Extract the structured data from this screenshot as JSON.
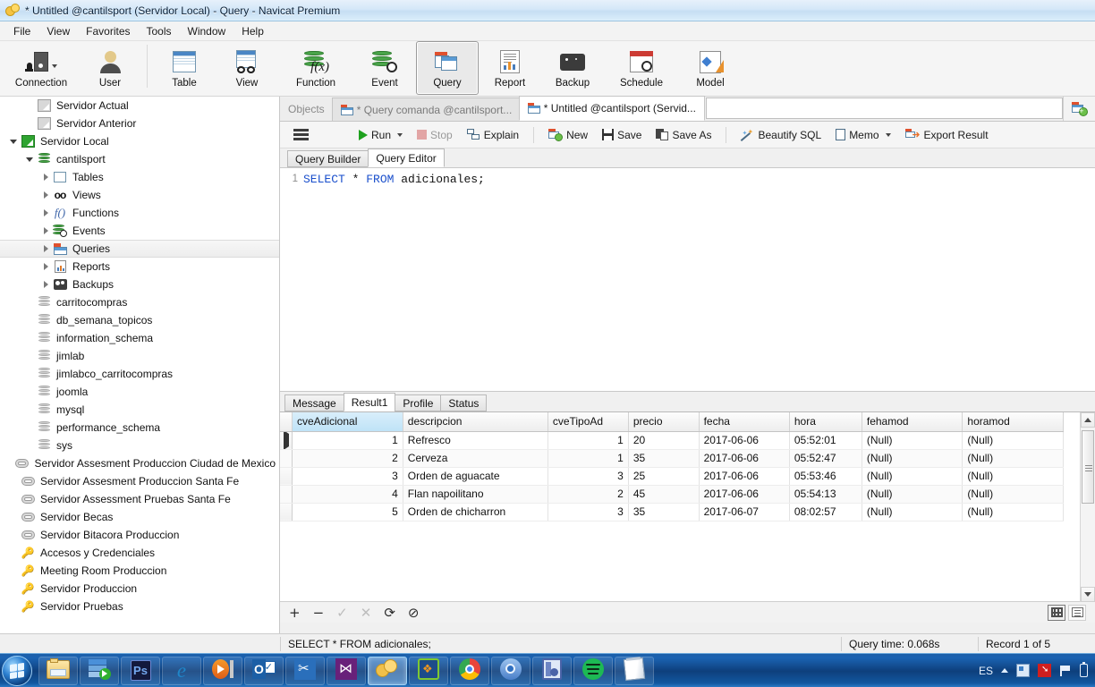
{
  "window": {
    "title": "* Untitled @cantilsport (Servidor Local) - Query - Navicat Premium",
    "logo_icon": "navicat-logo-icon"
  },
  "menubar": {
    "items": [
      "File",
      "View",
      "Favorites",
      "Tools",
      "Window",
      "Help"
    ]
  },
  "ribbon": {
    "groups": [
      {
        "buttons": [
          {
            "label": "Connection",
            "icon": "connection-icon",
            "has_dropdown": true,
            "active": false
          },
          {
            "label": "User",
            "icon": "user-icon",
            "has_dropdown": false,
            "active": false
          }
        ]
      },
      {
        "buttons": [
          {
            "label": "Table",
            "icon": "table-icon",
            "has_dropdown": false,
            "active": false
          },
          {
            "label": "View",
            "icon": "view-icon",
            "has_dropdown": false,
            "active": false
          },
          {
            "label": "Function",
            "icon": "function-icon",
            "has_dropdown": false,
            "active": false
          },
          {
            "label": "Event",
            "icon": "event-icon",
            "has_dropdown": false,
            "active": false
          },
          {
            "label": "Query",
            "icon": "query-icon",
            "has_dropdown": false,
            "active": true
          },
          {
            "label": "Report",
            "icon": "report-icon",
            "has_dropdown": false,
            "active": false
          },
          {
            "label": "Backup",
            "icon": "backup-icon",
            "has_dropdown": false,
            "active": false
          },
          {
            "label": "Schedule",
            "icon": "schedule-icon",
            "has_dropdown": false,
            "active": false
          },
          {
            "label": "Model",
            "icon": "model-icon",
            "has_dropdown": false,
            "active": false
          }
        ]
      }
    ]
  },
  "sidebar": {
    "items": [
      {
        "label": "Servidor Actual",
        "indent": 1,
        "icon": "server-offline-icon",
        "expander": "none",
        "selected": false
      },
      {
        "label": "Servidor Anterior",
        "indent": 1,
        "icon": "server-offline-icon",
        "expander": "none",
        "selected": false
      },
      {
        "label": "Servidor Local",
        "indent": 0,
        "icon": "server-online-icon",
        "expander": "expanded",
        "selected": false
      },
      {
        "label": "cantilsport",
        "indent": 1,
        "icon": "database-open-icon",
        "expander": "expanded",
        "selected": false
      },
      {
        "label": "Tables",
        "indent": 2,
        "icon": "table-icon",
        "expander": "collapsed",
        "selected": false
      },
      {
        "label": "Views",
        "indent": 2,
        "icon": "view-icon",
        "expander": "collapsed",
        "selected": false
      },
      {
        "label": "Functions",
        "indent": 2,
        "icon": "function-icon",
        "expander": "collapsed",
        "selected": false
      },
      {
        "label": "Events",
        "indent": 2,
        "icon": "event-icon",
        "expander": "collapsed",
        "selected": false
      },
      {
        "label": "Queries",
        "indent": 2,
        "icon": "query-icon",
        "expander": "collapsed",
        "selected": true
      },
      {
        "label": "Reports",
        "indent": 2,
        "icon": "report-icon",
        "expander": "collapsed",
        "selected": false
      },
      {
        "label": "Backups",
        "indent": 2,
        "icon": "backup-icon",
        "expander": "collapsed",
        "selected": false
      },
      {
        "label": "carritocompras",
        "indent": 1,
        "icon": "database-icon",
        "expander": "none",
        "selected": false
      },
      {
        "label": "db_semana_topicos",
        "indent": 1,
        "icon": "database-icon",
        "expander": "none",
        "selected": false
      },
      {
        "label": "information_schema",
        "indent": 1,
        "icon": "database-icon",
        "expander": "none",
        "selected": false
      },
      {
        "label": "jimlab",
        "indent": 1,
        "icon": "database-icon",
        "expander": "none",
        "selected": false
      },
      {
        "label": "jimlabco_carritocompras",
        "indent": 1,
        "icon": "database-icon",
        "expander": "none",
        "selected": false
      },
      {
        "label": "joomla",
        "indent": 1,
        "icon": "database-icon",
        "expander": "none",
        "selected": false
      },
      {
        "label": "mysql",
        "indent": 1,
        "icon": "database-icon",
        "expander": "none",
        "selected": false
      },
      {
        "label": "performance_schema",
        "indent": 1,
        "icon": "database-icon",
        "expander": "none",
        "selected": false
      },
      {
        "label": "sys",
        "indent": 1,
        "icon": "database-icon",
        "expander": "none",
        "selected": false
      },
      {
        "label": "Servidor Assesment Produccion Ciudad de Mexico",
        "indent": 0,
        "icon": "connection-icon",
        "expander": "none",
        "selected": false
      },
      {
        "label": "Servidor Assesment Produccion Santa Fe",
        "indent": 0,
        "icon": "connection-icon",
        "expander": "none",
        "selected": false
      },
      {
        "label": "Servidor Assessment Pruebas Santa Fe",
        "indent": 0,
        "icon": "connection-icon",
        "expander": "none",
        "selected": false
      },
      {
        "label": "Servidor Becas",
        "indent": 0,
        "icon": "connection-icon",
        "expander": "none",
        "selected": false
      },
      {
        "label": "Servidor Bitacora Produccion",
        "indent": 0,
        "icon": "connection-icon",
        "expander": "none",
        "selected": false
      },
      {
        "label": "Accesos y Credenciales",
        "indent": 0,
        "icon": "key-icon",
        "expander": "none",
        "selected": false
      },
      {
        "label": "Meeting Room Produccion",
        "indent": 0,
        "icon": "key-icon",
        "expander": "none",
        "selected": false
      },
      {
        "label": "Servidor Produccion",
        "indent": 0,
        "icon": "key-icon",
        "expander": "none",
        "selected": false
      },
      {
        "label": "Servidor Pruebas",
        "indent": 0,
        "icon": "key-icon",
        "expander": "none",
        "selected": false
      }
    ]
  },
  "tabstrip": {
    "tabs": [
      {
        "label": "Objects",
        "icon": "none",
        "active": false,
        "type": "objects"
      },
      {
        "label": "* Query comanda @cantilsport...",
        "icon": "query-tab-icon",
        "active": false,
        "type": "query"
      },
      {
        "label": "* Untitled @cantilsport (Servid...",
        "icon": "query-tab-icon",
        "active": true,
        "type": "query"
      }
    ],
    "add_tab_icon": "new-query-tab-icon",
    "search_value": "",
    "search_placeholder": ""
  },
  "query_toolbar": {
    "menu_icon": "hamburger-menu-icon",
    "buttons": [
      {
        "label": "Run",
        "icon": "run-play-icon",
        "has_dropdown": true,
        "enabled": true
      },
      {
        "label": "Stop",
        "icon": "stop-icon",
        "has_dropdown": false,
        "enabled": false
      },
      {
        "label": "Explain",
        "icon": "explain-icon",
        "has_dropdown": false,
        "enabled": true
      },
      {
        "label": "New",
        "icon": "new-query-icon",
        "has_dropdown": false,
        "enabled": true
      },
      {
        "label": "Save",
        "icon": "save-floppy-icon",
        "has_dropdown": false,
        "enabled": true
      },
      {
        "label": "Save As",
        "icon": "save-as-icon",
        "has_dropdown": false,
        "enabled": true
      },
      {
        "label": "Beautify SQL",
        "icon": "magic-wand-icon",
        "has_dropdown": false,
        "enabled": true
      },
      {
        "label": "Memo",
        "icon": "memo-icon",
        "has_dropdown": true,
        "enabled": true
      },
      {
        "label": "Export Result",
        "icon": "export-result-icon",
        "has_dropdown": false,
        "enabled": true
      }
    ]
  },
  "editor": {
    "subtabs": [
      {
        "label": "Query Builder",
        "active": false
      },
      {
        "label": "Query Editor",
        "active": true
      }
    ],
    "line_number": "1",
    "sql_tokens": [
      {
        "text": "SELECT",
        "type": "keyword"
      },
      {
        "text": " * ",
        "type": "operator"
      },
      {
        "text": "FROM",
        "type": "keyword"
      },
      {
        "text": " adicionales;",
        "type": "identifier"
      }
    ],
    "sql_text": "SELECT * FROM adicionales;"
  },
  "results": {
    "tabs": [
      {
        "label": "Message",
        "active": false
      },
      {
        "label": "Result1",
        "active": true
      },
      {
        "label": "Profile",
        "active": false
      },
      {
        "label": "Status",
        "active": false
      }
    ],
    "columns": [
      "cveAdicional",
      "descripcion",
      "cveTipoAd",
      "precio",
      "fecha",
      "hora",
      "fehamod",
      "horamod"
    ],
    "selected_column": "cveAdicional",
    "rows": [
      {
        "current": true,
        "cells": [
          "1",
          "Refresco",
          "1",
          "20",
          "2017-06-06",
          "05:52:01",
          "(Null)",
          "(Null)"
        ]
      },
      {
        "current": false,
        "cells": [
          "2",
          "Cerveza",
          "1",
          "35",
          "2017-06-06",
          "05:52:47",
          "(Null)",
          "(Null)"
        ]
      },
      {
        "current": false,
        "cells": [
          "3",
          "Orden de aguacate",
          "3",
          "25",
          "2017-06-06",
          "05:53:46",
          "(Null)",
          "(Null)"
        ]
      },
      {
        "current": false,
        "cells": [
          "4",
          "Flan napoilitano",
          "2",
          "45",
          "2017-06-06",
          "05:54:13",
          "(Null)",
          "(Null)"
        ]
      },
      {
        "current": false,
        "cells": [
          "5",
          "Orden de chicharron",
          "3",
          "35",
          "2017-06-07",
          "08:02:57",
          "(Null)",
          "(Null)"
        ]
      }
    ],
    "null_text": "(Null)",
    "toolbar": [
      {
        "icon": "add-record-icon",
        "symbol": "+",
        "enabled": true
      },
      {
        "icon": "delete-record-icon",
        "symbol": "−",
        "enabled": true
      },
      {
        "icon": "apply-changes-icon",
        "symbol": "✓",
        "enabled": false
      },
      {
        "icon": "cancel-changes-icon",
        "symbol": "✕",
        "enabled": false
      },
      {
        "icon": "refresh-icon",
        "symbol": "⟳",
        "enabled": true
      },
      {
        "icon": "stop-loading-icon",
        "symbol": "⊘",
        "enabled": true
      }
    ],
    "view_modes": [
      {
        "icon": "grid-view-icon",
        "active": true
      },
      {
        "icon": "form-view-icon",
        "active": false
      }
    ]
  },
  "statusbar": {
    "sql": "SELECT * FROM adicionales;",
    "query_time": "Query time: 0.068s",
    "record_info": "Record 1 of 5"
  },
  "taskbar": {
    "start_icon": "windows-start-orb-icon",
    "buttons": [
      {
        "icon": "file-explorer-icon",
        "active": false
      },
      {
        "icon": "sql-server-icon",
        "active": false
      },
      {
        "icon": "photoshop-icon",
        "active": false
      },
      {
        "icon": "internet-explorer-icon",
        "active": false
      },
      {
        "icon": "media-player-icon",
        "active": false
      },
      {
        "icon": "outlook-icon",
        "active": false
      },
      {
        "icon": "tools-icon",
        "active": false
      },
      {
        "icon": "visual-studio-icon",
        "active": false
      },
      {
        "icon": "navicat-icon",
        "active": true
      },
      {
        "icon": "virtualbox-icon",
        "active": false
      },
      {
        "icon": "chrome-icon",
        "active": false
      },
      {
        "icon": "chromium-icon",
        "active": false
      },
      {
        "icon": "contacts-icon",
        "active": false
      },
      {
        "icon": "spotify-icon",
        "active": false
      },
      {
        "icon": "notepad-icon",
        "active": false
      }
    ],
    "tray": {
      "language": "ES",
      "show_hidden_icon": "show-hidden-icons-icon",
      "icons": [
        "tray-app-icon",
        "tray-cursor-icon",
        "tray-flag-icon",
        "battery-icon"
      ]
    }
  }
}
